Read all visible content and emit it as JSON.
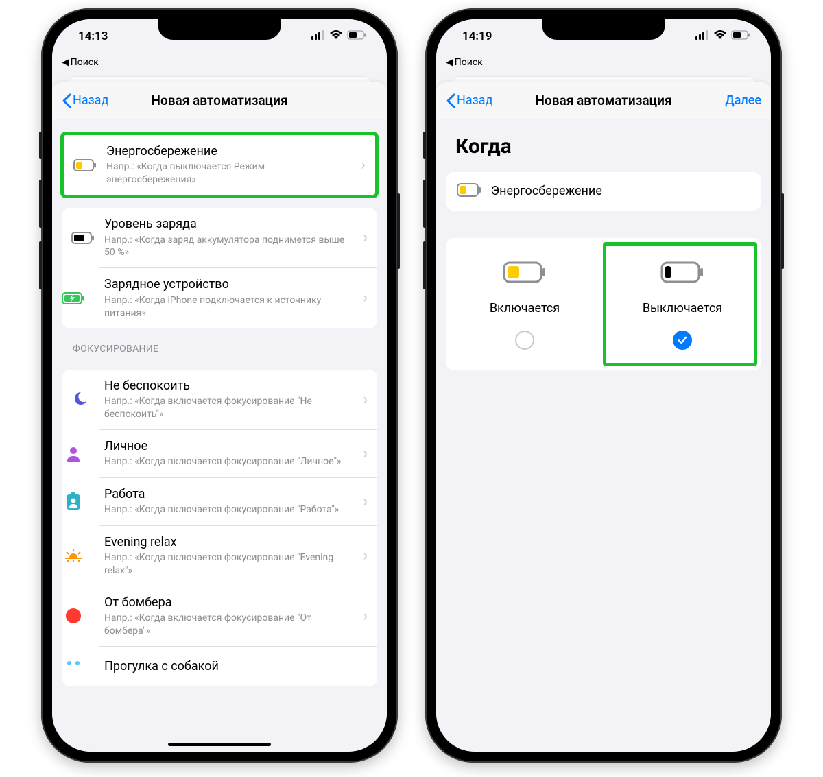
{
  "left": {
    "status": {
      "time": "14:13",
      "breadcrumb": "Поиск"
    },
    "nav": {
      "back": "Назад",
      "title": "Новая автоматизация"
    },
    "battery_section": [
      {
        "title": "Энергосбережение",
        "sub": "Напр.: «Когда выключается Режим энергосбережения»"
      },
      {
        "title": "Уровень заряда",
        "sub": "Напр.: «Когда заряд аккумулятора поднимется выше 50 %»"
      },
      {
        "title": "Зарядное устройство",
        "sub": "Напр.: «Когда iPhone подключается к источнику питания»"
      }
    ],
    "focus_header": "ФОКУСИРОВАНИЕ",
    "focus_section": [
      {
        "title": "Не беспокоить",
        "sub": "Напр.: «Когда включается фокусирование \"Не беспокоить\"»"
      },
      {
        "title": "Личное",
        "sub": "Напр.: «Когда включается фокусирование \"Личное\"»"
      },
      {
        "title": "Работа",
        "sub": "Напр.: «Когда включается фокусирование \"Работа\"»"
      },
      {
        "title": "Evening relax",
        "sub": "Напр.: «Когда включается фокусирование \"Evening relax\"»"
      },
      {
        "title": "От бомбера",
        "sub": "Напр.: «Когда включается фокусирование \"От бомбера\"»"
      },
      {
        "title": "Прогулка с собакой",
        "sub": ""
      }
    ]
  },
  "right": {
    "status": {
      "time": "14:19",
      "breadcrumb": "Поиск"
    },
    "nav": {
      "back": "Назад",
      "title": "Новая автоматизация",
      "next": "Далее"
    },
    "heading": "Когда",
    "summary": "Энергосбережение",
    "choices": {
      "on": "Включается",
      "off": "Выключается"
    }
  }
}
